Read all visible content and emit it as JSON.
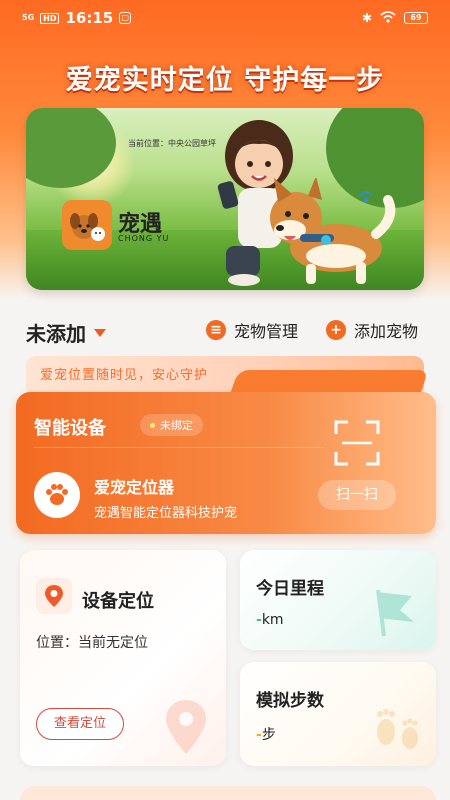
{
  "status_bar": {
    "signal": "5G",
    "hd": "HD",
    "time": "16:15",
    "battery": "69"
  },
  "header": {
    "slogan": "爱宠实时定位 守护每一步"
  },
  "banner": {
    "location_label": "当前位置：中央公园草坪",
    "brand_name": "宠遇",
    "brand_sub": "CHONG YU"
  },
  "pet_bar": {
    "selector_label": "未添加",
    "manage_label": "宠物管理",
    "add_label": "添加宠物"
  },
  "tagline": "爱宠位置随时见，安心守护",
  "device": {
    "title": "智能设备",
    "status_badge": "未绑定",
    "product_name": "爱宠定位器",
    "product_desc": "宠遇智能定位器科技护宠",
    "scan_label": "扫一扫"
  },
  "location_card": {
    "title": "设备定位",
    "text": "位置：当前无定位",
    "button": "查看定位"
  },
  "mileage_card": {
    "title": "今日里程",
    "value": "-",
    "unit": "km"
  },
  "steps_card": {
    "title": "模拟步数",
    "value": "-",
    "unit": "步"
  },
  "colors": {
    "accent": "#f36a22",
    "mileage_accent": "#4bbf7a",
    "steps_accent": "#e2b220"
  }
}
